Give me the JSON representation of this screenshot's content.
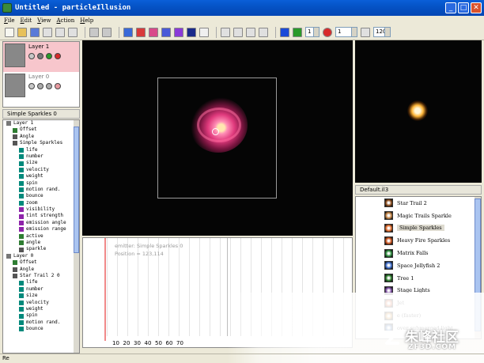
{
  "window": {
    "title": "Untitled - particleIllusion"
  },
  "menu": [
    "File",
    "Edit",
    "View",
    "Action",
    "Help"
  ],
  "toolbar": {
    "frame_value": "1",
    "frame_value_2": "1",
    "fps_value": "120"
  },
  "layers": [
    {
      "name": "Layer 1",
      "selected": true
    },
    {
      "name": "Layer 0",
      "selected": false
    }
  ],
  "emitter_panel": {
    "header": "Simple Sparkles 0"
  },
  "tree": [
    {
      "label": "Layer 1",
      "color": "#777777"
    },
    {
      "label": "Offset",
      "color": "#2e7d32"
    },
    {
      "label": "Angle",
      "color": "#555555"
    },
    {
      "label": "Simple Sparkles",
      "color": "#555555"
    },
    {
      "label": "life",
      "color": "#00897b"
    },
    {
      "label": "number",
      "color": "#00897b"
    },
    {
      "label": "size",
      "color": "#00897b"
    },
    {
      "label": "velocity",
      "color": "#00897b"
    },
    {
      "label": "weight",
      "color": "#00897b"
    },
    {
      "label": "spin",
      "color": "#00897b"
    },
    {
      "label": "motion rand.",
      "color": "#00897b"
    },
    {
      "label": "bounce",
      "color": "#00897b"
    },
    {
      "label": "zoom",
      "color": "#00897b"
    },
    {
      "label": "visibility",
      "color": "#8e24aa"
    },
    {
      "label": "tint strength",
      "color": "#8e24aa"
    },
    {
      "label": "emission angle",
      "color": "#8e24aa"
    },
    {
      "label": "emission range",
      "color": "#8e24aa"
    },
    {
      "label": "active",
      "color": "#2e7d32"
    },
    {
      "label": "angle",
      "color": "#2e7d32"
    },
    {
      "label": "sparkle",
      "color": "#555555"
    },
    {
      "label": "Layer 0",
      "color": "#777777"
    },
    {
      "label": "Offset",
      "color": "#2e7d32"
    },
    {
      "label": "Angle",
      "color": "#555555"
    },
    {
      "label": "Star Trail 2 0",
      "color": "#555555"
    },
    {
      "label": "life",
      "color": "#00897b"
    },
    {
      "label": "number",
      "color": "#00897b"
    },
    {
      "label": "size",
      "color": "#00897b"
    },
    {
      "label": "velocity",
      "color": "#00897b"
    },
    {
      "label": "weight",
      "color": "#00897b"
    },
    {
      "label": "spin",
      "color": "#00897b"
    },
    {
      "label": "motion rand.",
      "color": "#00897b"
    },
    {
      "label": "bounce",
      "color": "#00897b"
    }
  ],
  "library": {
    "header": "Default.il3",
    "items": [
      {
        "label": "Star Trail 2",
        "selected": false,
        "color": "#8a4a1a"
      },
      {
        "label": "Magic Trails Sparkle",
        "selected": false,
        "color": "#c08040"
      },
      {
        "label": "Simple Sparkles",
        "selected": true,
        "color": "#e06a2a"
      },
      {
        "label": "Heavy Fire Sparkles",
        "selected": false,
        "color": "#c8501a"
      },
      {
        "label": "Matrix Falls",
        "selected": false,
        "color": "#2a8a3a"
      },
      {
        "label": "Space Jellyfish 2",
        "selected": false,
        "color": "#3a6ac8"
      },
      {
        "label": "Tree 1",
        "selected": false,
        "color": "#2a7a2a"
      },
      {
        "label": "Stage Lights",
        "selected": false,
        "color": "#7a4aa0"
      },
      {
        "label": "Jet",
        "selected": false,
        "color": "#d84a1a"
      },
      {
        "label": "e (faster)",
        "selected": false,
        "color": "#c87a1a"
      },
      {
        "label": "over submerged light",
        "selected": false,
        "color": "#2a5aa0"
      }
    ]
  },
  "timeline": {
    "emitter_label": "emitter: Simple Sparkles 0",
    "position_label": "Position = 123,114",
    "ticks": [
      "10",
      "20",
      "30",
      "40",
      "50",
      "60",
      "70"
    ]
  },
  "watermark": {
    "cn": "朱峰社区",
    "url": "ZF3D.COM"
  },
  "status": {
    "text": "Re"
  }
}
